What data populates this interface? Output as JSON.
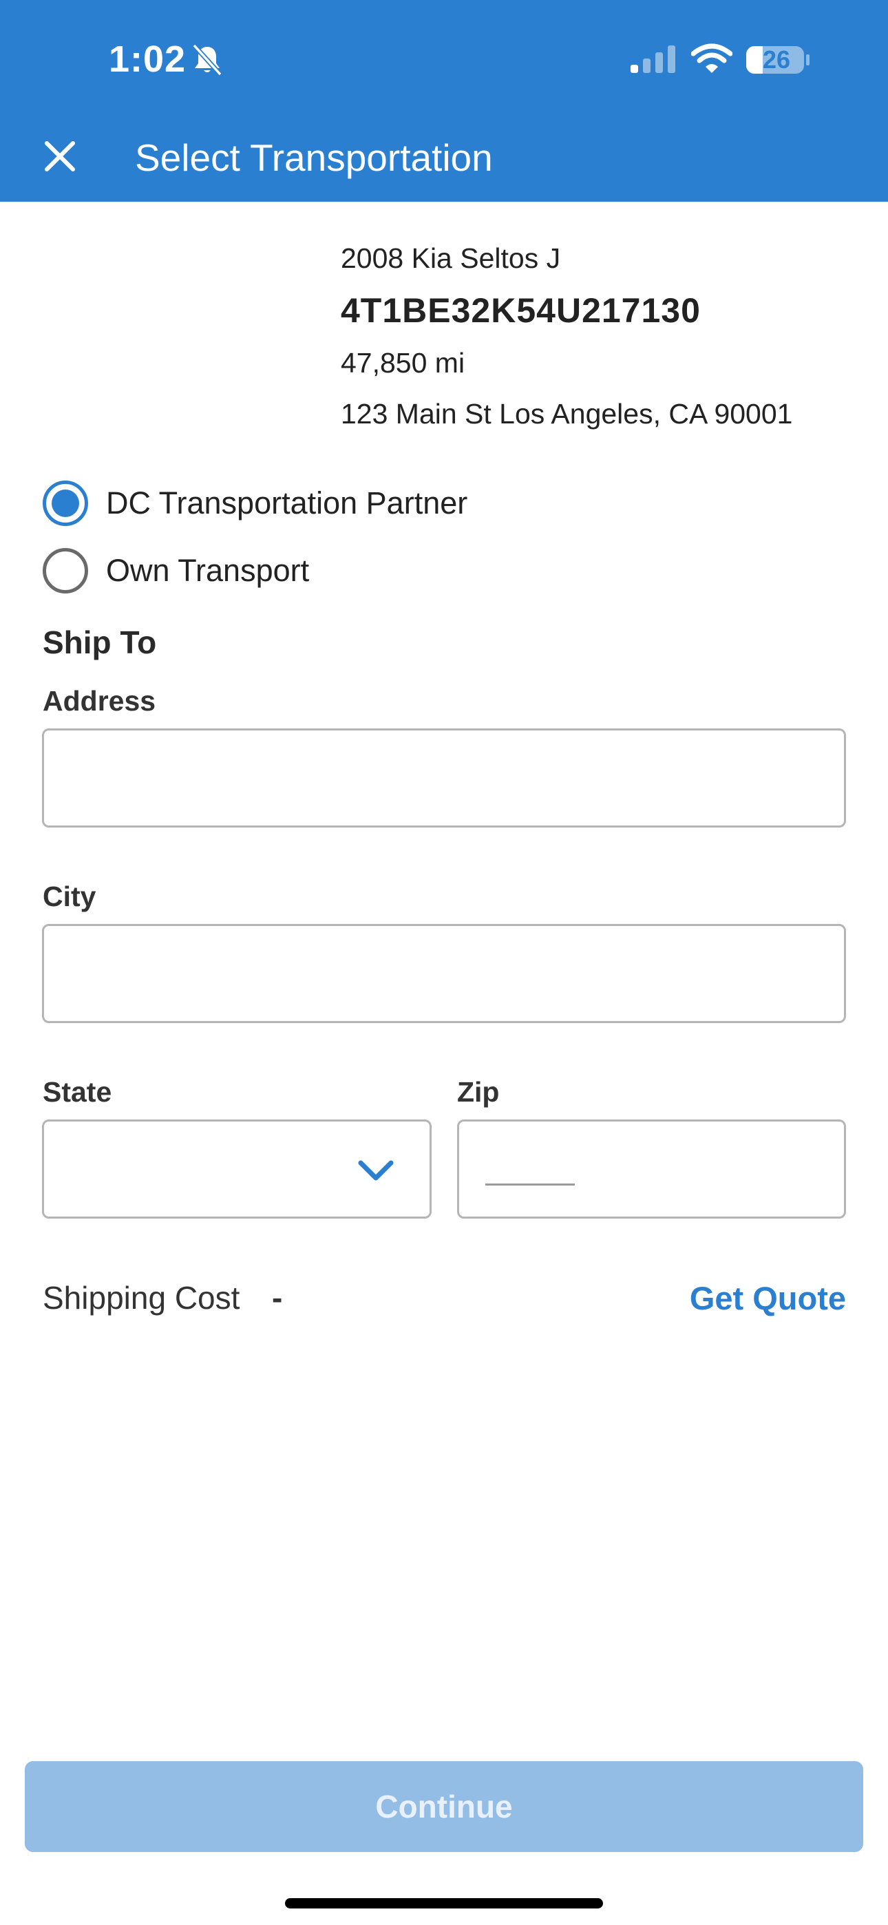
{
  "status_bar": {
    "time": "1:02",
    "battery": "26"
  },
  "header": {
    "title": "Select Transportation"
  },
  "vehicle": {
    "title": "2008 Kia Seltos J",
    "vin": "4T1BE32K54U217130",
    "mileage": "47,850 mi",
    "address": "123 Main St Los Angeles, CA 90001"
  },
  "transport_options": [
    {
      "label": "DC Transportation Partner",
      "selected": true
    },
    {
      "label": "Own Transport",
      "selected": false
    }
  ],
  "ship_to": {
    "title": "Ship To",
    "address_label": "Address",
    "address_value": "",
    "city_label": "City",
    "city_value": "",
    "state_label": "State",
    "state_value": "",
    "zip_label": "Zip",
    "zip_value": ""
  },
  "shipping": {
    "label": "Shipping Cost",
    "value": "-",
    "quote_label": "Get Quote"
  },
  "footer": {
    "continue_label": "Continue"
  },
  "colors": {
    "brand": "#2b7fd0",
    "button_disabled": "#94bde6"
  }
}
